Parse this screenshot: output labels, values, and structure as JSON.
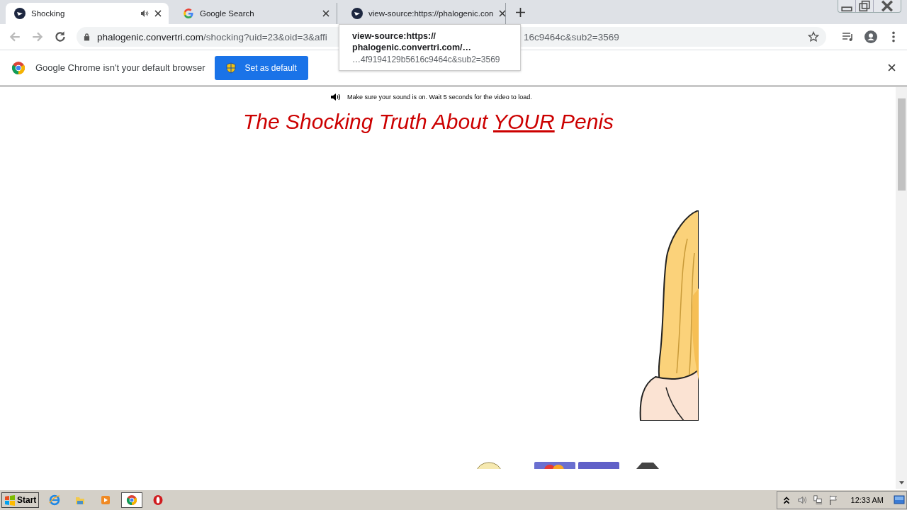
{
  "tabs": [
    {
      "title": "Shocking",
      "selected": true,
      "audio": true
    },
    {
      "title": "Google Search",
      "selected": false,
      "audio": false
    },
    {
      "title": "view-source:https://phalogenic.con",
      "selected": false,
      "audio": false
    }
  ],
  "omnibox": {
    "host": "phalogenic.convertri.com",
    "path": "/shocking?uid=23&oid=3&affi",
    "tail": "16c9464c&sub2=3569"
  },
  "tooltip": {
    "lines": [
      "view-source:https://",
      "phalogenic.convertri.com/…"
    ],
    "detail": "…4f9194129b5616c9464c&sub2=3569"
  },
  "infobar": {
    "message": "Google Chrome isn't your default browser",
    "button": "Set as default"
  },
  "page": {
    "sound_notice": "Make sure your sound is on. Wait 5 seconds for the video to load.",
    "headline": [
      {
        "text": "The Shocking Truth About ",
        "underline": false
      },
      {
        "text": "YOUR",
        "underline": true
      },
      {
        "text": " Penis",
        "underline": false
      }
    ]
  },
  "taskbar": {
    "start": "Start",
    "apps": [
      {
        "kind": "ie",
        "active": false
      },
      {
        "kind": "folder",
        "active": false
      },
      {
        "kind": "media",
        "active": false
      },
      {
        "kind": "chrome",
        "active": true
      },
      {
        "kind": "opera",
        "active": false
      }
    ],
    "clock": "12:33 AM"
  }
}
